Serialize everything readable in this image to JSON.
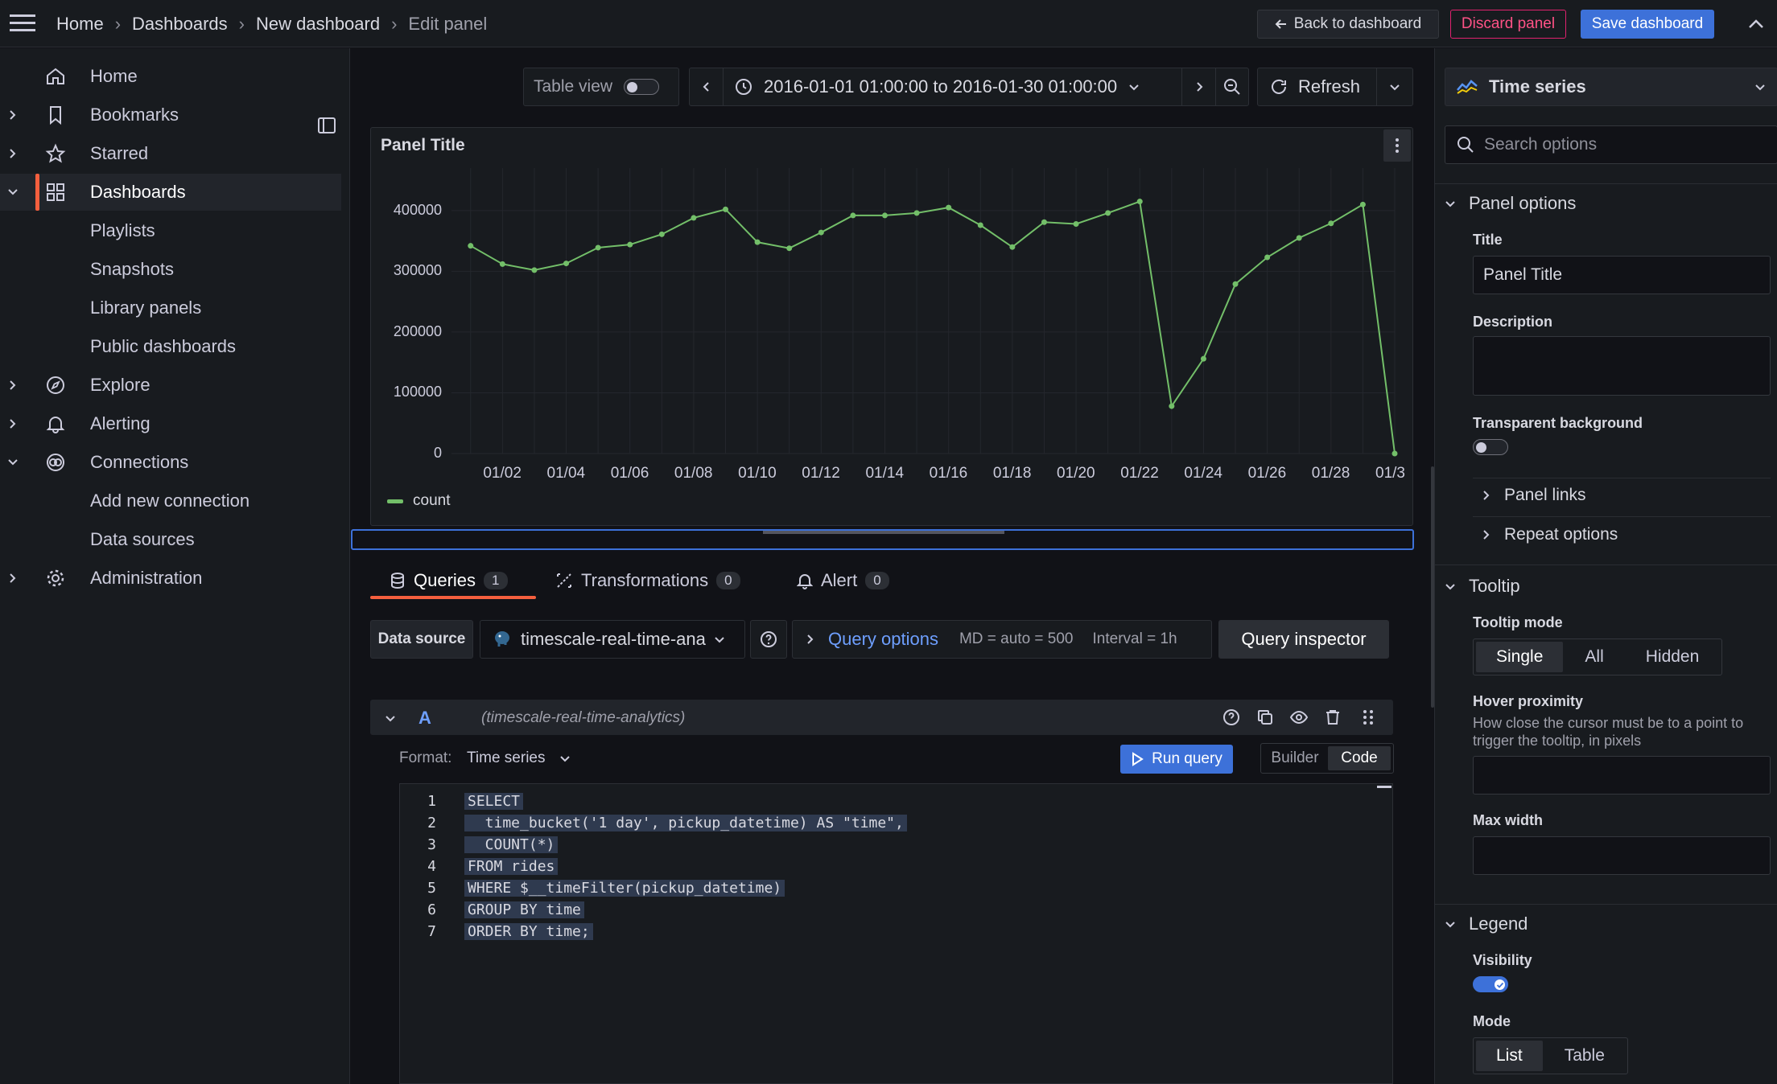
{
  "breadcrumbs": [
    "Home",
    "Dashboards",
    "New dashboard",
    "Edit panel"
  ],
  "topbar": {
    "back_label": "Back to dashboard",
    "discard_label": "Discard panel",
    "save_label": "Save dashboard"
  },
  "sidebar": {
    "items": [
      {
        "label": "Home",
        "icon": "home-icon"
      },
      {
        "label": "Bookmarks",
        "icon": "bookmark-icon"
      },
      {
        "label": "Starred",
        "icon": "star-icon"
      },
      {
        "label": "Dashboards",
        "icon": "dashboards-grid-icon"
      },
      {
        "label": "Playlists"
      },
      {
        "label": "Snapshots"
      },
      {
        "label": "Library panels"
      },
      {
        "label": "Public dashboards"
      },
      {
        "label": "Explore",
        "icon": "compass-icon"
      },
      {
        "label": "Alerting",
        "icon": "bell-icon"
      },
      {
        "label": "Connections",
        "icon": "connections-icon"
      },
      {
        "label": "Add new connection"
      },
      {
        "label": "Data sources"
      },
      {
        "label": "Administration",
        "icon": "gear-icon"
      }
    ]
  },
  "toolbar": {
    "table_view_label": "Table view",
    "time_range": "2016-01-01 01:00:00 to 2016-01-30 01:00:00",
    "refresh_label": "Refresh"
  },
  "panel": {
    "title": "Panel Title"
  },
  "chart_data": {
    "type": "line",
    "title": "Panel Title",
    "x_ticks": [
      "01/02",
      "01/04",
      "01/06",
      "01/08",
      "01/10",
      "01/12",
      "01/14",
      "01/16",
      "01/18",
      "01/20",
      "01/22",
      "01/24",
      "01/26",
      "01/28",
      "01/3"
    ],
    "y_ticks": [
      "0",
      "100000",
      "200000",
      "300000",
      "400000"
    ],
    "ylim": [
      0,
      470000
    ],
    "xlim": [
      0.4,
      30.0
    ],
    "grid": true,
    "legend_placement": "bottom-left",
    "series": [
      {
        "name": "count",
        "color": "#73bf69",
        "x": [
          1,
          2,
          3,
          4,
          5,
          6,
          7,
          8,
          9,
          10,
          11,
          12,
          13,
          14,
          15,
          16,
          17,
          18,
          19,
          20,
          21,
          22,
          23,
          24,
          25,
          26,
          27,
          28,
          29,
          30
        ],
        "y": [
          342000,
          312000,
          302000,
          313000,
          339000,
          344000,
          361000,
          388000,
          402000,
          348000,
          338000,
          364000,
          392000,
          392000,
          396000,
          405000,
          376000,
          340000,
          381000,
          378000,
          396000,
          415000,
          78000,
          156000,
          279000,
          323000,
          355000,
          379000,
          410000,
          0
        ]
      }
    ]
  },
  "tabs": [
    {
      "label": "Queries",
      "count": "1"
    },
    {
      "label": "Transformations",
      "count": "0"
    },
    {
      "label": "Alert",
      "count": "0"
    }
  ],
  "query_row": {
    "data_source_label": "Data source",
    "data_source_value": "timescale-real-time-ana",
    "query_options_label": "Query options",
    "md_text": "MD = auto = 500",
    "interval_text": "Interval = 1h",
    "inspector_label": "Query inspector"
  },
  "query": {
    "ref_id": "A",
    "datasource_note": "(timescale-real-time-analytics)",
    "format_label": "Format:",
    "format_value": "Time series",
    "run_label": "Run query",
    "builder_label": "Builder",
    "code_label": "Code",
    "code_lines": [
      "SELECT",
      "  time_bucket('1 day', pickup_datetime) AS \"time\",",
      "  COUNT(*)",
      "FROM rides",
      "WHERE $__timeFilter(pickup_datetime)",
      "GROUP BY time",
      "ORDER BY time;"
    ]
  },
  "options": {
    "visualization": "Time series",
    "search_placeholder": "Search options",
    "panel_options_header": "Panel options",
    "title_label": "Title",
    "title_value": "Panel Title",
    "description_label": "Description",
    "transparent_label": "Transparent background",
    "panel_links_label": "Panel links",
    "repeat_options_label": "Repeat options",
    "tooltip_header": "Tooltip",
    "tooltip_mode_label": "Tooltip mode",
    "tooltip_modes": [
      "Single",
      "All",
      "Hidden"
    ],
    "hover_label": "Hover proximity",
    "hover_desc": "How close the cursor must be to a point to trigger the tooltip, in pixels",
    "max_width_label": "Max width",
    "legend_header": "Legend",
    "visibility_label": "Visibility",
    "mode_label": "Mode",
    "legend_modes": [
      "List",
      "Table"
    ]
  }
}
